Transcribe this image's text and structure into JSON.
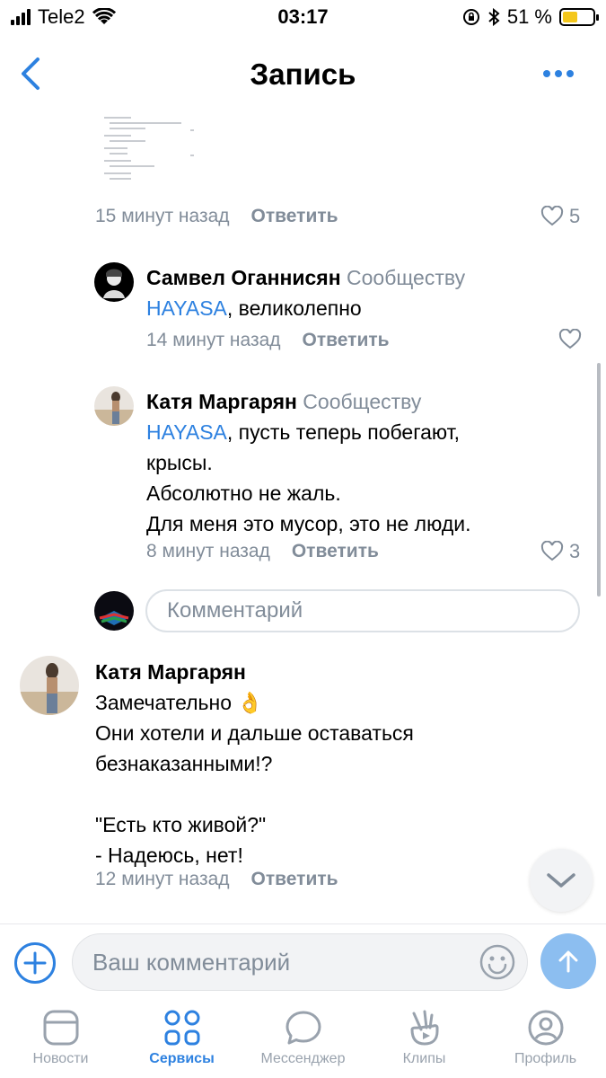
{
  "status_bar": {
    "carrier": "Tele2",
    "time": "03:17",
    "battery_percent": "51 %",
    "battery_level": 0.51
  },
  "nav": {
    "title": "Запись"
  },
  "comments": [
    {
      "meta_time": "15 минут назад",
      "reply_label": "Ответить",
      "likes": "5"
    },
    {
      "author": "Самвел Оганнисян",
      "addressee": "Сообществу",
      "mention": "HAYASA",
      "text": ", великолепно",
      "meta_time": "14 минут назад",
      "reply_label": "Ответить",
      "likes": ""
    },
    {
      "author": "Катя Маргарян",
      "addressee": "Сообществу",
      "mention": "HAYASA",
      "text_lines": [
        ", пусть теперь побегают,",
        "крысы.",
        "Абсолютно не жаль.",
        "Для меня это мусор, это не люди."
      ],
      "meta_time": "8 минут назад",
      "reply_label": "Ответить",
      "likes": "3"
    },
    {
      "author": "Катя Маргарян",
      "text_lines": [
        "Замечательно 👌",
        "Они хотели и дальше оставаться",
        "безнаказанными!?",
        "",
        "\"Есть кто живой?\"",
        "- Надеюсь, нет!"
      ],
      "meta_time": "12 минут назад",
      "reply_label": "Ответить"
    }
  ],
  "reply_input": {
    "placeholder": "Комментарий"
  },
  "composer": {
    "placeholder": "Ваш комментарий"
  },
  "tabs": [
    {
      "label": "Новости",
      "icon": "news-icon",
      "active": false
    },
    {
      "label": "Сервисы",
      "icon": "services-icon",
      "active": true
    },
    {
      "label": "Мессенджер",
      "icon": "messenger-icon",
      "active": false
    },
    {
      "label": "Клипы",
      "icon": "clips-icon",
      "active": false
    },
    {
      "label": "Профиль",
      "icon": "profile-icon",
      "active": false
    }
  ],
  "colors": {
    "accent": "#2d81e0",
    "secondary_text": "#818c99",
    "send_button": "#8cbef0"
  }
}
